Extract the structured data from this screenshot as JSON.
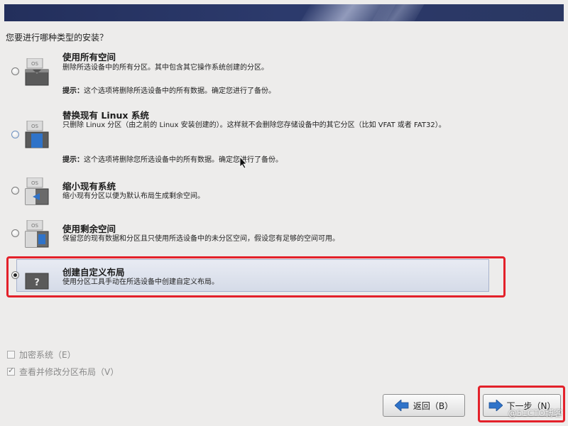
{
  "question": "您要进行哪种类型的安装？",
  "options": [
    {
      "title": "使用所有空间",
      "desc": "删除所选设备中的所有分区。其中包含其它操作系统创建的分区。",
      "hint_label": "提示：",
      "hint": "这个选项将删除所选设备中的所有数据。确定您进行了备份。",
      "icon": "os-disk-icon",
      "selected": false
    },
    {
      "title": "替换现有 Linux 系统",
      "desc": "只删除 Linux 分区（由之前的 Linux 安装创建的）。这样就不会删除您存储设备中的其它分区（比如 VFAT 或者 FAT32）。",
      "hint_label": "提示：",
      "hint": "这个选项将删除您所选设备中的所有数据。确定您进行了备份。",
      "icon": "os-replace-icon",
      "selected": false
    },
    {
      "title": "缩小现有系统",
      "desc": "缩小现有分区以便为默认布局生成剩余空间。",
      "icon": "os-shrink-icon",
      "selected": false
    },
    {
      "title": "使用剩余空间",
      "desc": "保留您的现有数据和分区且只使用所选设备中的未分区空间，假设您有足够的空间可用。",
      "icon": "os-free-space-icon",
      "selected": false
    },
    {
      "title": "创建自定义布局",
      "desc": "使用分区工具手动在所选设备中创建自定义布局。",
      "icon": "custom-layout-icon",
      "icon_glyph": "?",
      "selected": true
    }
  ],
  "os_label": "OS",
  "checkboxes": [
    {
      "label": "加密系统（E）",
      "checked": false
    },
    {
      "label": "查看并修改分区布局（V）",
      "checked": true
    }
  ],
  "buttons": {
    "back": "返回（B）",
    "next": "下一步（N）"
  },
  "watermark": "@51CTO博客",
  "colors": {
    "banner": "#2a3762",
    "highlight_outline": "#e3212a",
    "selected_bg": "#d5dbe8",
    "arrow_blue": "#2f73c9"
  }
}
